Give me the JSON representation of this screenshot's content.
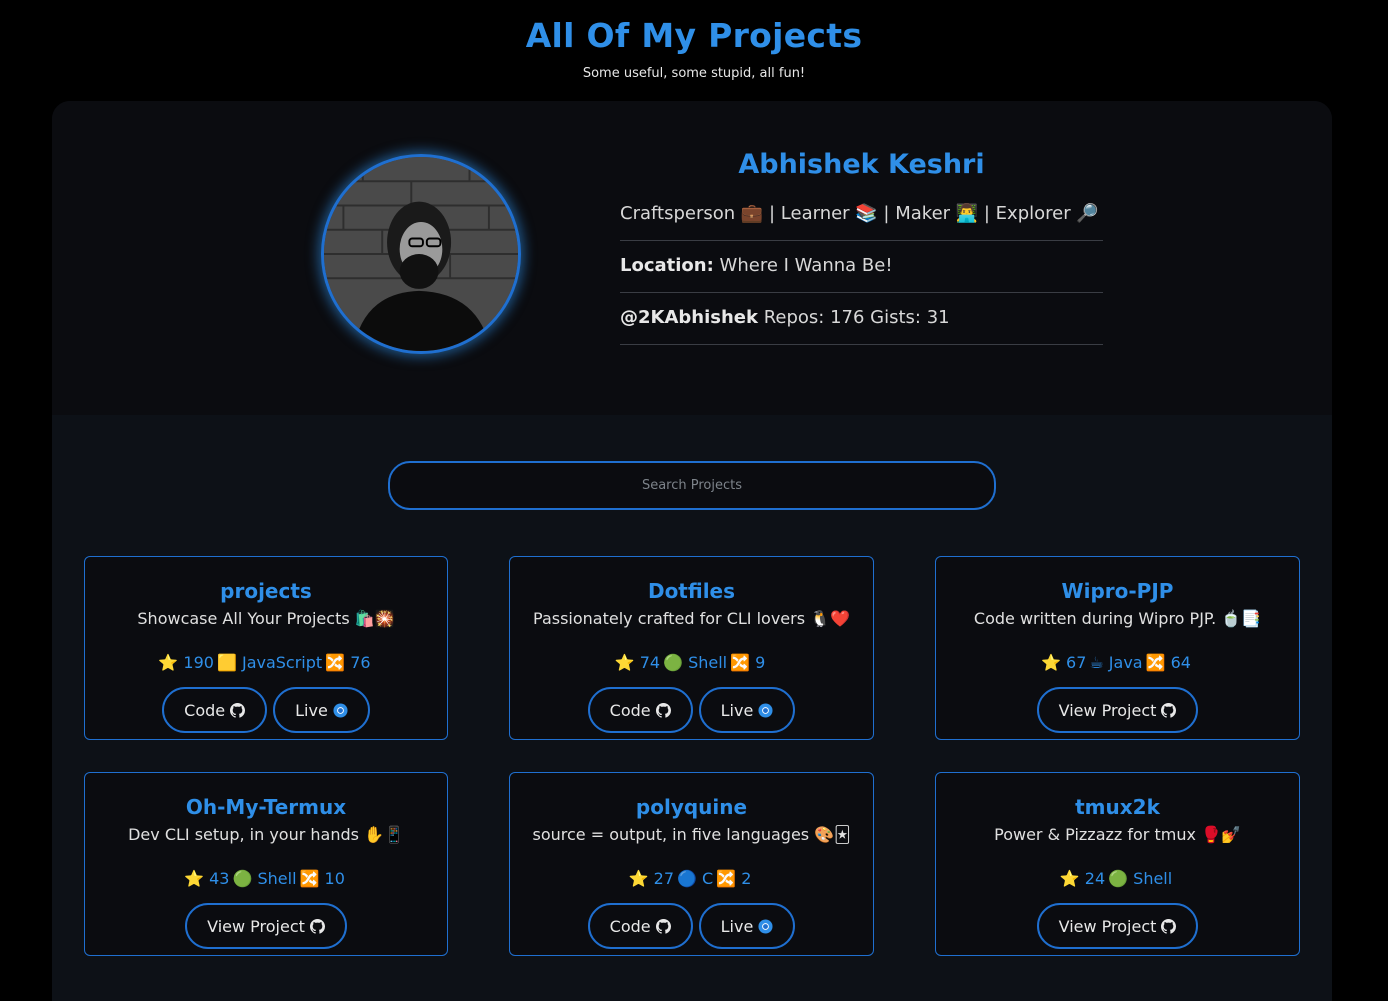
{
  "header": {
    "title": "All Of My Projects",
    "subtitle": "Some useful, some stupid, all fun!"
  },
  "profile": {
    "name": "Abhishek Keshri",
    "tagline": "Craftsperson 💼 | Learner 📚 | Maker 👨‍💻 | Explorer 🔎",
    "location_label": "Location:",
    "location_value": "Where I Wanna Be!",
    "handle": "@2KAbhishek",
    "stats": "Repos: 176 Gists: 31"
  },
  "search": {
    "placeholder": "Search Projects"
  },
  "projects": [
    {
      "name": "projects",
      "description": "Showcase All Your Projects 🛍️🎇",
      "stars": "⭐ 190",
      "language": "🟨 JavaScript",
      "forks": "🔀 76",
      "buttons": [
        "Code",
        "Live"
      ]
    },
    {
      "name": "Dotfiles",
      "description": "Passionately crafted for CLI lovers 🐧❤️",
      "stars": "⭐ 74",
      "language": "🟢 Shell",
      "forks": "🔀 9",
      "buttons": [
        "Code",
        "Live"
      ]
    },
    {
      "name": "Wipro-PJP",
      "description": "Code written during Wipro PJP. 🍵📑",
      "stars": "⭐ 67",
      "language": "☕ Java",
      "forks": "🔀 64",
      "buttons": [
        "View Project"
      ]
    },
    {
      "name": "Oh-My-Termux",
      "description": "Dev CLI setup, in your hands ✋📱",
      "stars": "⭐ 43",
      "language": "🟢 Shell",
      "forks": "🔀 10",
      "buttons": [
        "View Project"
      ]
    },
    {
      "name": "polyquine",
      "description": "source = output, in five languages 🎨🃏",
      "stars": "⭐ 27",
      "language": "🔵 C",
      "forks": "🔀 2",
      "buttons": [
        "Code",
        "Live"
      ]
    },
    {
      "name": "tmux2k",
      "description": "Power & Pizzazz for tmux 🥊💅",
      "stars": "⭐ 24",
      "language": "🟢 Shell",
      "forks": "",
      "buttons": [
        "View Project"
      ]
    }
  ],
  "colors": {
    "accent": "#2f8fe8",
    "border": "#1f6fd0",
    "background": "#000000",
    "panel": "#0d1117"
  }
}
